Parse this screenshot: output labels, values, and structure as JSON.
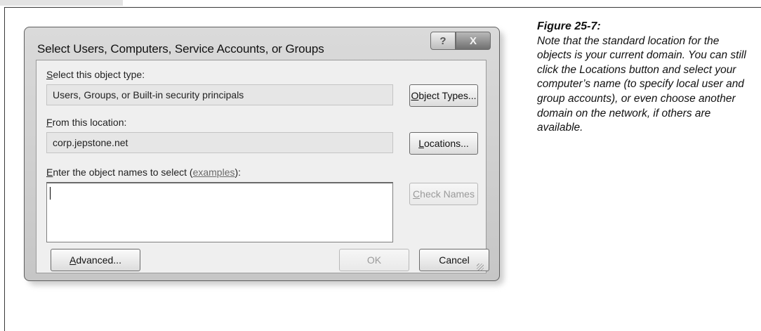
{
  "dialog": {
    "title": "Select Users, Computers, Service Accounts, or Groups",
    "help_glyph": "?",
    "close_glyph": "X",
    "object_type": {
      "label_key": "S",
      "label_rest": "elect this object type:",
      "value": "Users, Groups, or Built-in security principals",
      "button_key": "O",
      "button_rest": "bject Types..."
    },
    "location": {
      "label_key": "F",
      "label_rest": "rom this location:",
      "value": "corp.jepstone.net",
      "button_key": "L",
      "button_rest": "ocations..."
    },
    "names": {
      "label_key": "E",
      "label_rest": "nter the object names to select (",
      "label_link": "examples",
      "label_end": "):",
      "value": "",
      "check_key": "C",
      "check_rest": "heck Names"
    },
    "advanced_key": "A",
    "advanced_rest": "dvanced...",
    "ok_label": "OK",
    "cancel_label": "Cancel"
  },
  "caption": {
    "title": "Figure 25-7:",
    "body": "Note that the standard location for the objects is your current domain. You can still click the Locations button and select your computer’s name (to specify local user and group accounts), or even choose another domain on the network, if others are available."
  }
}
